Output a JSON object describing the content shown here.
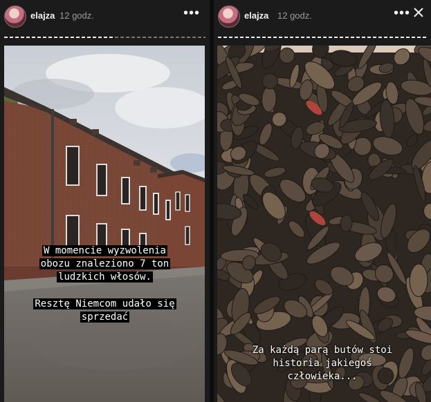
{
  "stories": [
    {
      "username": "elajza",
      "time": "12 godz.",
      "progress": 0.55,
      "caption_lines": [
        "W momencie wyzwolenia",
        "obozu znaleziono 7 ton",
        "ludzkich włosów."
      ],
      "caption2_lines": [
        "Resztę Niemcom udało się",
        "sprzedać"
      ]
    },
    {
      "username": "elajza",
      "time": "12 godz.",
      "progress": 1.0,
      "caption_lines": [
        "Za każdą parą butów stoi",
        "historia jakiegoś",
        "człowieka..."
      ]
    }
  ],
  "icons": {
    "more": "more-options-icon",
    "close": "close-icon",
    "avatar": "avatar"
  },
  "colors": {
    "background": "#1b1b1b",
    "caption_bg": "#000000",
    "text": "#ffffff"
  }
}
